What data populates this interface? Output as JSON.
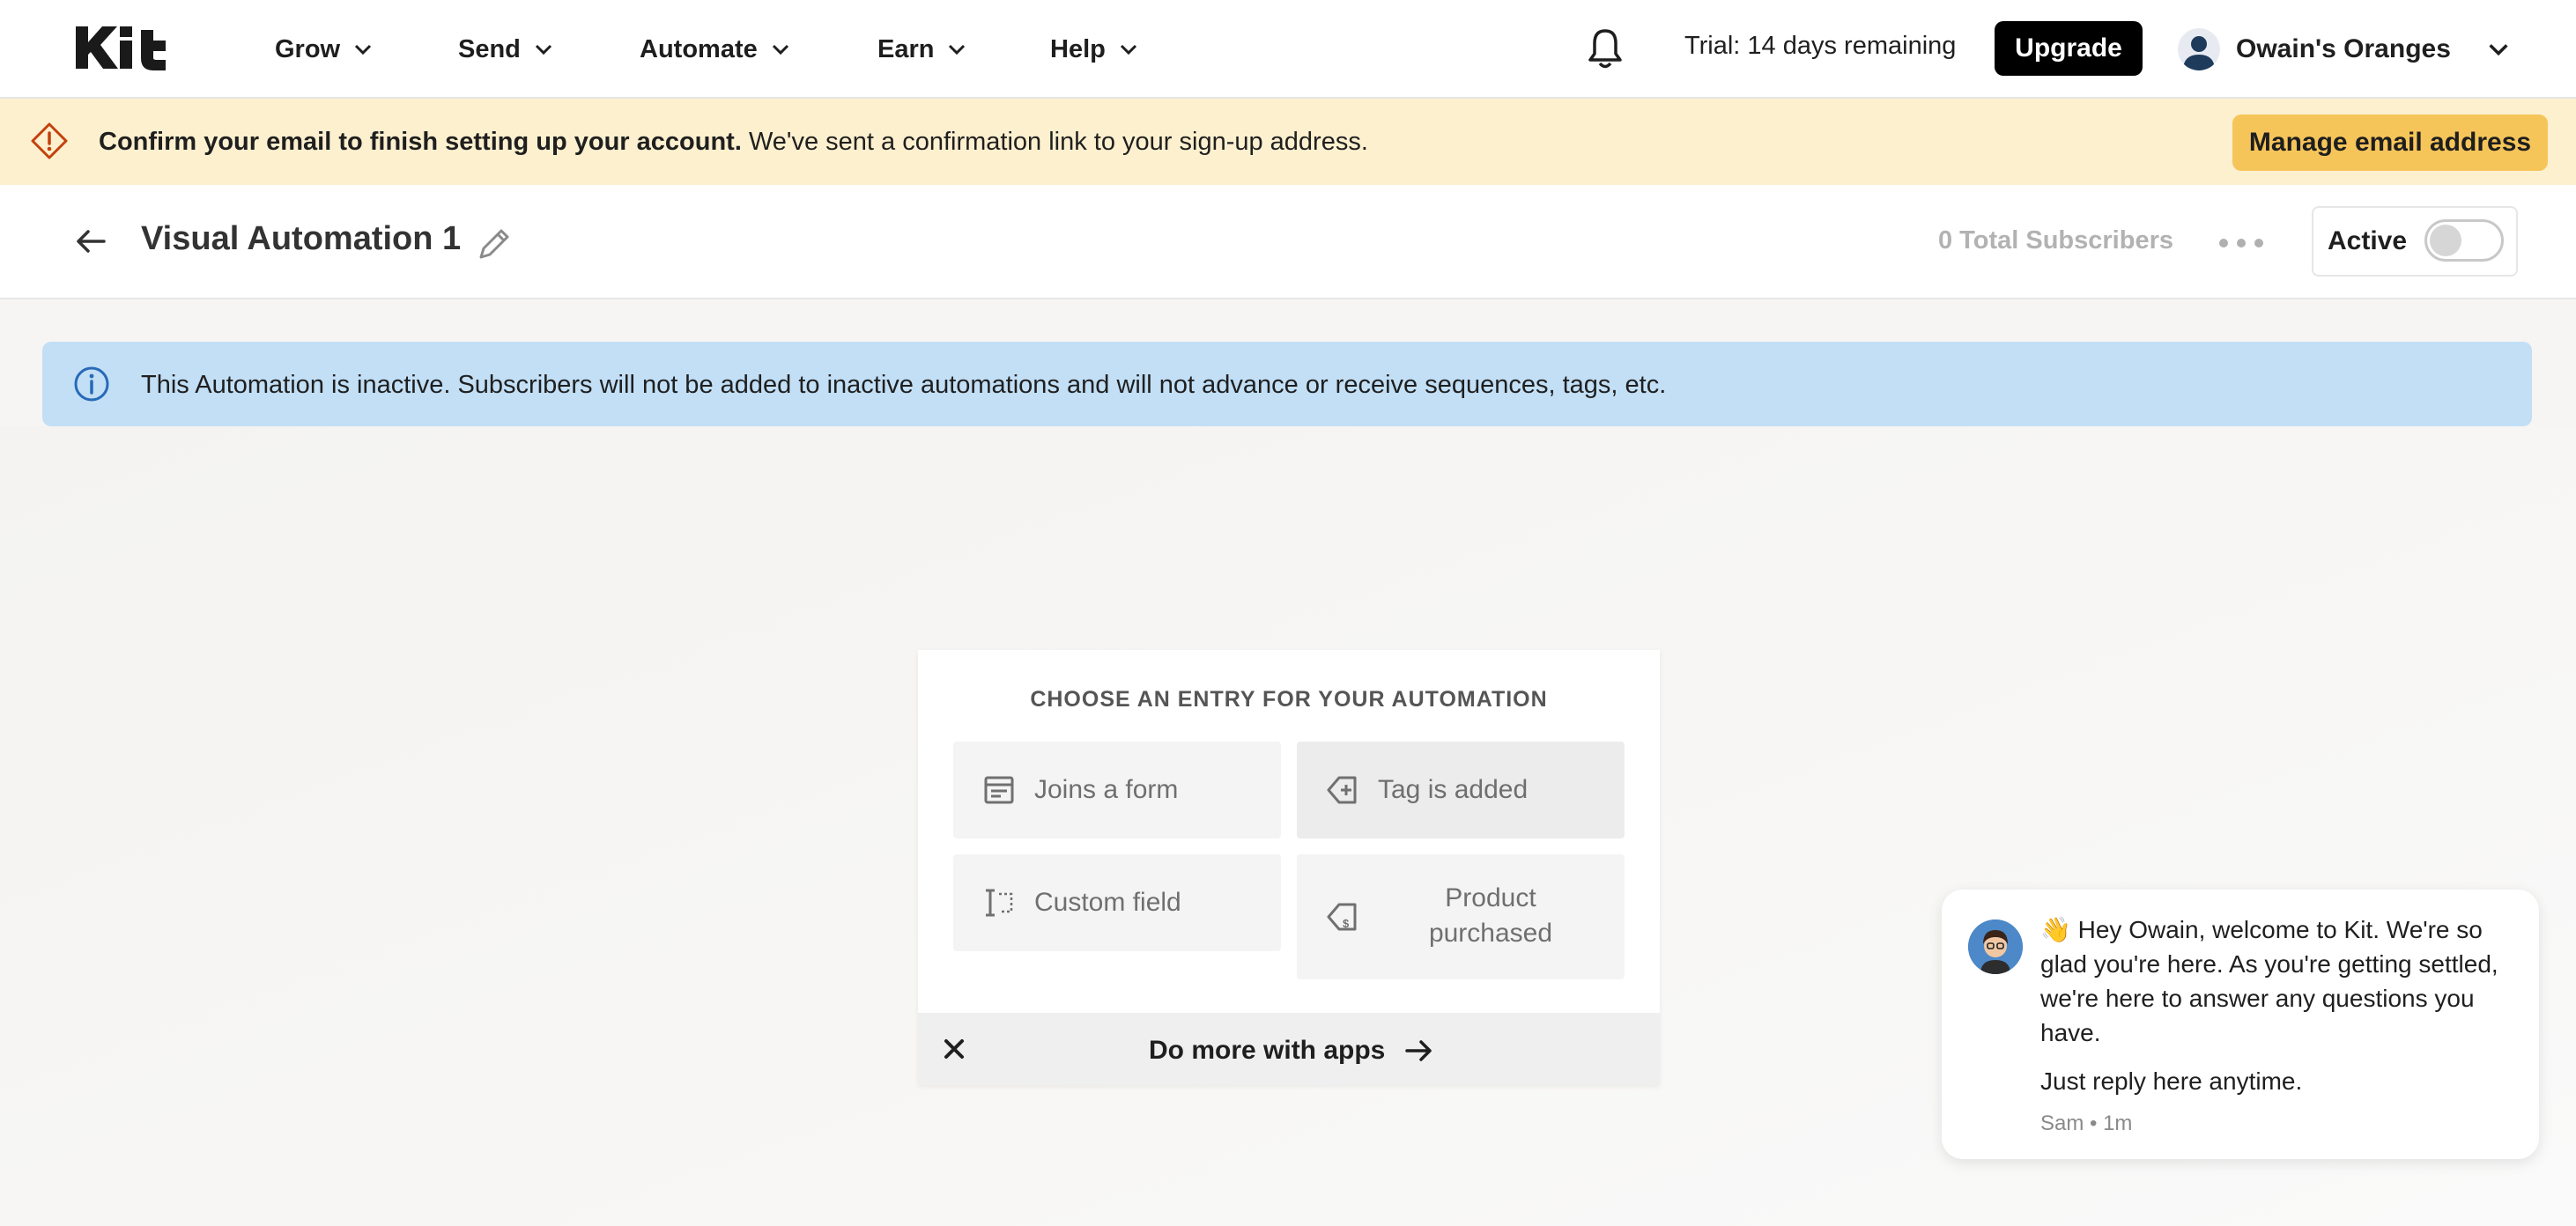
{
  "nav": {
    "logo_text": "Kit",
    "items": [
      {
        "label": "Grow"
      },
      {
        "label": "Send"
      },
      {
        "label": "Automate"
      },
      {
        "label": "Earn"
      },
      {
        "label": "Help"
      }
    ],
    "trial_text": "Trial: 14 days remaining",
    "upgrade_label": "Upgrade",
    "account_name": "Owain's Oranges"
  },
  "confirm_banner": {
    "bold_text": "Confirm your email to finish setting up your account.",
    "text": " We've sent a confirmation link to your sign-up address.",
    "button_label": "Manage email address"
  },
  "automation": {
    "title": "Visual Automation 1",
    "total_subscribers": "0 Total Subscribers",
    "active_label": "Active",
    "active": false
  },
  "info_banner": {
    "text": "This Automation is inactive. Subscribers will not be added to inactive automations and will not advance or receive sequences, tags, etc."
  },
  "entry": {
    "heading": "CHOOSE AN ENTRY FOR YOUR AUTOMATION",
    "options": [
      {
        "label": "Joins a form",
        "icon": "form-icon"
      },
      {
        "label": "Tag is added",
        "icon": "tag-add-icon"
      },
      {
        "label": "Custom field",
        "icon": "custom-field-icon"
      },
      {
        "label": "Product purchased",
        "icon": "tag-dollar-icon"
      }
    ],
    "apps_label": "Do more with apps"
  },
  "chat": {
    "message": "👋 Hey Owain, welcome to Kit. We're so glad you're here. As you're getting settled, we're here to answer any questions you have.",
    "reply": "Just reply here anytime.",
    "meta": "Sam • 1m"
  },
  "colors": {
    "confirm_banner_bg": "#fdf0cf",
    "manage_button": "#f6c55a",
    "info_banner_bg": "#c2dff6",
    "upgrade_button": "#000000"
  }
}
